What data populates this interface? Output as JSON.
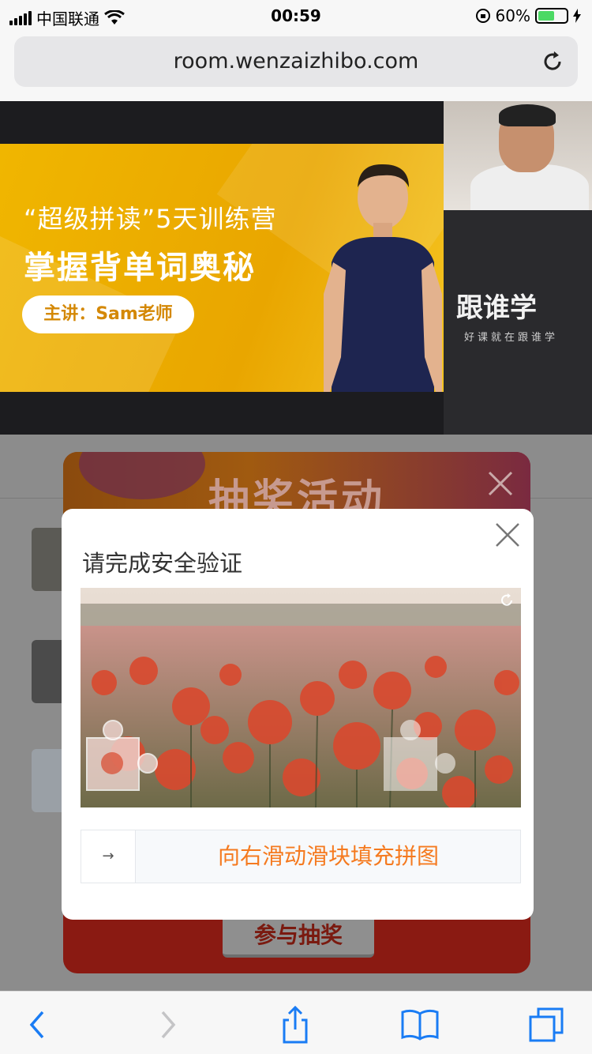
{
  "status_bar": {
    "carrier": "中国联通",
    "time": "00:59",
    "battery_percent": "60%",
    "battery_level": 0.6
  },
  "browser": {
    "url": "room.wenzaizhibo.com"
  },
  "video": {
    "banner_subtitle": "“超级拼读”5天训练营",
    "banner_title": "掌握背单词奥秘",
    "banner_speaker": "主讲：Sam老师",
    "brand_name": "跟谁学",
    "brand_slogan": "好课就在跟谁学"
  },
  "lottery": {
    "title": "抽奖活动",
    "join_label": "参与抽奖"
  },
  "captcha": {
    "heading": "请完成安全验证",
    "slider_hint": "向右滑动滑块填充拼图",
    "knob_arrow": "→"
  },
  "icons": {
    "signal": "signal-icon",
    "wifi": "wifi-icon",
    "lock_rotation": "rotation-lock-icon",
    "reload": "reload-icon",
    "back": "chevron-left-icon",
    "forward": "chevron-right-icon",
    "share": "share-icon",
    "bookmarks": "book-icon",
    "tabs": "tabs-icon",
    "close": "close-icon",
    "refresh": "refresh-icon"
  },
  "colors": {
    "accent_orange": "#f57a1f",
    "banner_yellow": "#f0b600",
    "lottery_red": "#8a1a12"
  }
}
